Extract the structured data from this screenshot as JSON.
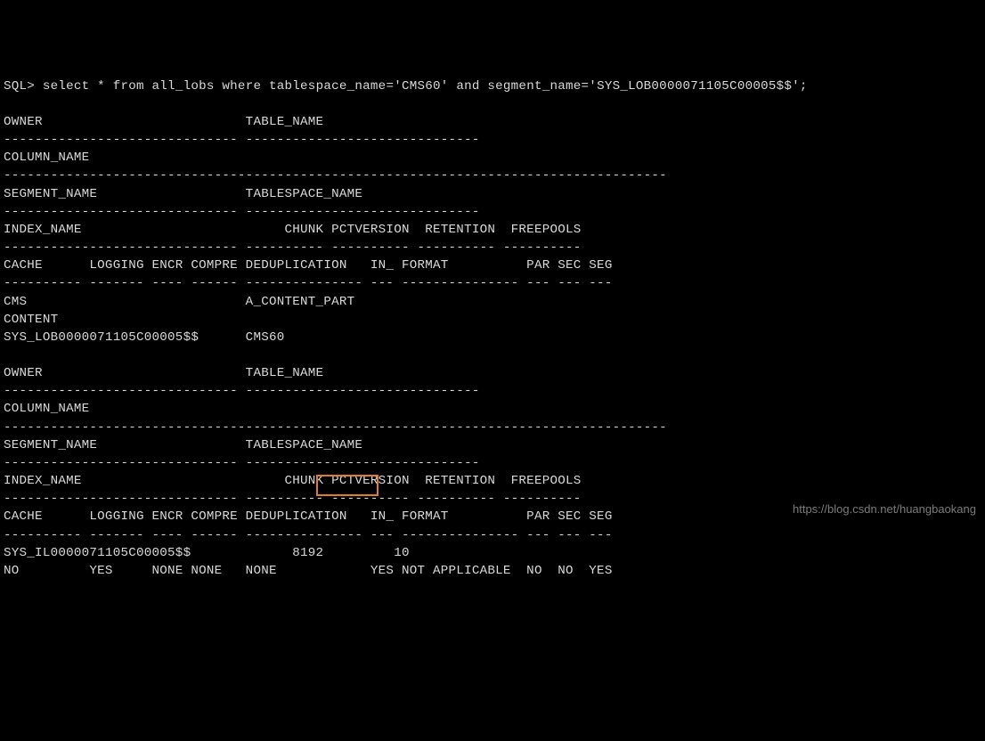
{
  "prompt": "SQL> ",
  "sql_command": "select * from all_lobs where tablespace_name='CMS60' and segment_name='SYS_LOB0000071105C00005$$';",
  "header_block": {
    "row1": "OWNER                          TABLE_NAME",
    "dash1": "------------------------------ ------------------------------",
    "row2": "COLUMN_NAME",
    "dash2": "-------------------------------------------------------------------------------------",
    "row3": "SEGMENT_NAME                   TABLESPACE_NAME",
    "dash3": "------------------------------ ------------------------------",
    "row4": "INDEX_NAME                          CHUNK PCTVERSION  RETENTION  FREEPOOLS",
    "dash4": "------------------------------ ---------- ---------- ---------- ----------",
    "row5": "CACHE      LOGGING ENCR COMPRE DEDUPLICATION   IN_ FORMAT          PAR SEC SEG",
    "dash5": "---------- ------- ---- ------ --------------- --- --------------- --- --- ---"
  },
  "record1": {
    "line1": "CMS                            A_CONTENT_PART",
    "line2": "CONTENT",
    "line3": "SYS_LOB0000071105C00005$$      CMS60"
  },
  "record2": {
    "line1": "SYS_IL0000071105C00005$$             8192         10",
    "line2": "NO         YES     NONE NONE   NONE            YES NOT APPLICABLE  NO  NO  YES"
  },
  "watermark": "https://blog.csdn.net/huangbaokang",
  "chart_data": {
    "type": "table",
    "title": "ALL_LOBS query result",
    "columns": [
      "OWNER",
      "TABLE_NAME",
      "COLUMN_NAME",
      "SEGMENT_NAME",
      "TABLESPACE_NAME",
      "INDEX_NAME",
      "CHUNK",
      "PCTVERSION",
      "RETENTION",
      "FREEPOOLS",
      "CACHE",
      "LOGGING",
      "ENCR",
      "COMPRE",
      "DEDUPLICATION",
      "IN_",
      "FORMAT",
      "PAR",
      "SEC",
      "SEG"
    ],
    "rows": [
      {
        "OWNER": "CMS",
        "TABLE_NAME": "A_CONTENT_PART",
        "COLUMN_NAME": "CONTENT",
        "SEGMENT_NAME": "SYS_LOB0000071105C00005$$",
        "TABLESPACE_NAME": "CMS60",
        "INDEX_NAME": "SYS_IL0000071105C00005$$",
        "CHUNK": 8192,
        "PCTVERSION": 10,
        "RETENTION": null,
        "FREEPOOLS": null,
        "CACHE": "NO",
        "LOGGING": "YES",
        "ENCR": "NONE",
        "COMPRE": "NONE",
        "DEDUPLICATION": "NONE",
        "IN_": "YES",
        "FORMAT": "NOT APPLICABLE",
        "PAR": "NO",
        "SEC": "NO",
        "SEG": "YES"
      }
    ]
  }
}
